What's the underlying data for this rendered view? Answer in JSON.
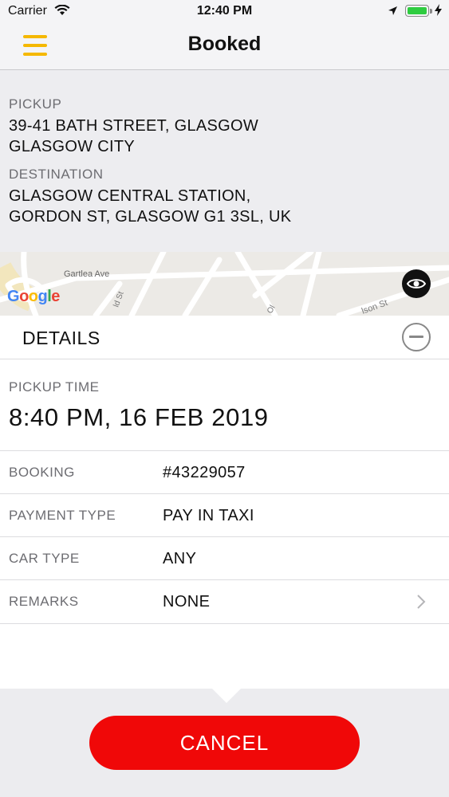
{
  "status_bar": {
    "carrier": "Carrier",
    "time": "12:40 PM"
  },
  "nav": {
    "title": "Booked"
  },
  "route": {
    "pickup_label": "PICKUP",
    "pickup_line1": "39-41 BATH STREET, GLASGOW",
    "pickup_line2": "GLASGOW CITY",
    "destination_label": "DESTINATION",
    "destination_line1": "GLASGOW CENTRAL STATION,",
    "destination_line2": "GORDON ST, GLASGOW G1 3SL, UK"
  },
  "map": {
    "street_1": "Gartlea Ave",
    "street_2": "ld St",
    "street_3": "Ol",
    "street_4": "lson St",
    "google_logo": "Google"
  },
  "details": {
    "title": "DETAILS",
    "pickup_time_label": "PICKUP TIME",
    "pickup_time_value": "8:40 PM, 16 FEB 2019",
    "rows": [
      {
        "label": "BOOKING",
        "value": "#43229057"
      },
      {
        "label": "PAYMENT TYPE",
        "value": "PAY IN TAXI"
      },
      {
        "label": "CAR TYPE",
        "value": "ANY"
      },
      {
        "label": "REMARKS",
        "value": "NONE"
      }
    ]
  },
  "actions": {
    "cancel_label": "CANCEL"
  },
  "colors": {
    "menu_icon": "#f5b800",
    "cancel_button": "#f00808",
    "battery": "#2ecc40"
  },
  "icons": [
    "wifi-icon",
    "location-arrow-icon",
    "battery-icon",
    "charging-bolt-icon",
    "hamburger-menu-icon",
    "eye-icon",
    "minus-circle-icon",
    "chevron-right-icon"
  ]
}
